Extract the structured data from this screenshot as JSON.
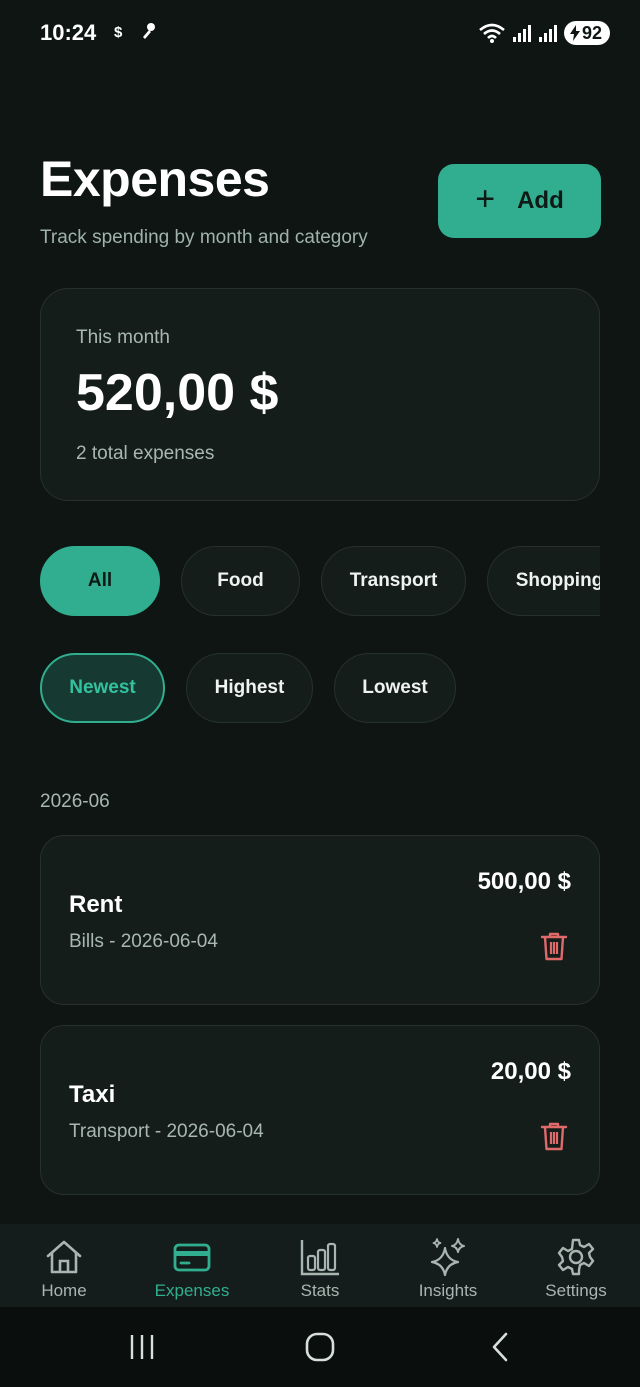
{
  "status_bar": {
    "time": "10:24",
    "notif_dollar": "$",
    "battery": "92"
  },
  "header": {
    "title": "Expenses",
    "subtitle": "Track spending by month and category",
    "add_label": "Add"
  },
  "summary": {
    "label": "This month",
    "amount": "520,00 $",
    "count_text": "2 total expenses"
  },
  "category_filters": [
    {
      "label": "All",
      "selected": true
    },
    {
      "label": "Food",
      "selected": false
    },
    {
      "label": "Transport",
      "selected": false
    },
    {
      "label": "Shopping",
      "selected": false
    }
  ],
  "sort_options": [
    {
      "label": "Newest",
      "selected": true
    },
    {
      "label": "Highest",
      "selected": false
    },
    {
      "label": "Lowest",
      "selected": false
    }
  ],
  "groups": [
    {
      "month": "2026-06",
      "expenses": [
        {
          "name": "Rent",
          "meta": "Bills - 2026-06-04",
          "amount": "500,00 $"
        },
        {
          "name": "Taxi",
          "meta": "Transport - 2026-06-04",
          "amount": "20,00 $"
        }
      ]
    }
  ],
  "bottom_nav": [
    {
      "label": "Home",
      "icon": "home-icon",
      "active": false
    },
    {
      "label": "Expenses",
      "icon": "card-icon",
      "active": true
    },
    {
      "label": "Stats",
      "icon": "bar-chart-icon",
      "active": false
    },
    {
      "label": "Insights",
      "icon": "sparkles-icon",
      "active": false
    },
    {
      "label": "Settings",
      "icon": "gear-icon",
      "active": false
    }
  ],
  "colors": {
    "accent": "#31ae8f",
    "background": "#0e1513",
    "card": "#151d1b",
    "danger": "#e06a6a"
  }
}
